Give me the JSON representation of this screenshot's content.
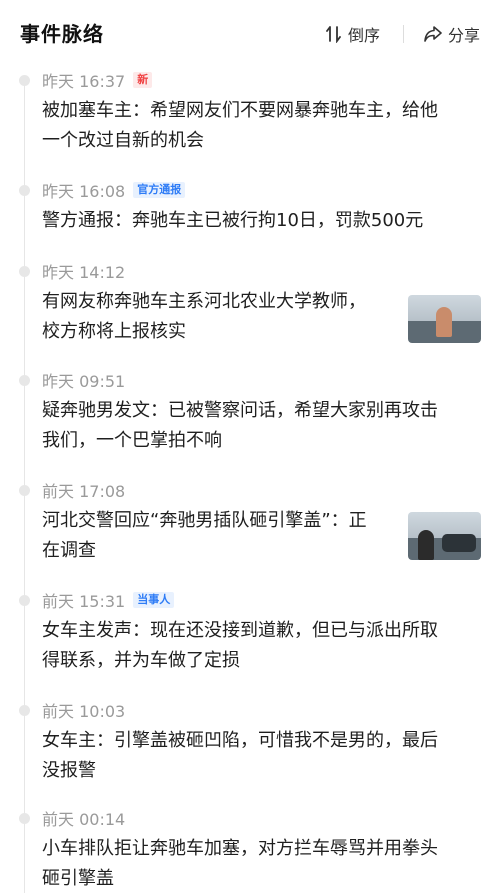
{
  "header": {
    "title": "事件脉络",
    "sort_label": "倒序",
    "share_label": "分享"
  },
  "events": [
    {
      "time": "昨天 16:37",
      "badge": "新",
      "badge_type": "new",
      "lines": [
        "被加塞车主：希望网友们不要网暴奔驰车主，给他",
        "一个改过自新的机会"
      ],
      "thumbnail": false
    },
    {
      "time": "昨天 16:08",
      "badge": "官方通报",
      "badge_type": "official",
      "lines": [
        "警方通报：奔驰车主已被行拘10日，罚款500元"
      ],
      "thumbnail": false
    },
    {
      "time": "昨天 14:12",
      "badge": "",
      "badge_type": "",
      "lines": [
        "有网友称奔驰车主系河北农业大学教师，",
        "校方称将上报核实"
      ],
      "thumbnail": true
    },
    {
      "time": "昨天 09:51",
      "badge": "",
      "badge_type": "",
      "lines": [
        "疑奔驰男发文：已被警察问话，希望大家别再攻击",
        "我们，一个巴掌拍不响"
      ],
      "thumbnail": false
    },
    {
      "time": "前天 17:08",
      "badge": "",
      "badge_type": "",
      "lines": [
        "河北交警回应“奔驰男插队砸引擎盖”：正",
        "在调查"
      ],
      "thumbnail": true
    },
    {
      "time": "前天 15:31",
      "badge": "当事人",
      "badge_type": "party",
      "lines": [
        "女车主发声：现在还没接到道歉，但已与派出所取",
        "得联系，并为车做了定损"
      ],
      "thumbnail": false
    },
    {
      "time": "前天 10:03",
      "badge": "",
      "badge_type": "",
      "lines": [
        "女车主：引擎盖被砸凹陷，可惜我不是男的，最后",
        "没报警"
      ],
      "thumbnail": false
    },
    {
      "time": "前天 00:14",
      "badge": "",
      "badge_type": "",
      "lines": [
        "小车排队拒让奔驰车加塞，对方拦车辱骂并用拳头",
        "砸引擎盖"
      ],
      "thumbnail": false
    }
  ],
  "colors": {
    "badge_new": "#f04142",
    "badge_blue": "#2e7cf6",
    "time": "#9a9a9a",
    "dot": "#e7e7e7"
  }
}
